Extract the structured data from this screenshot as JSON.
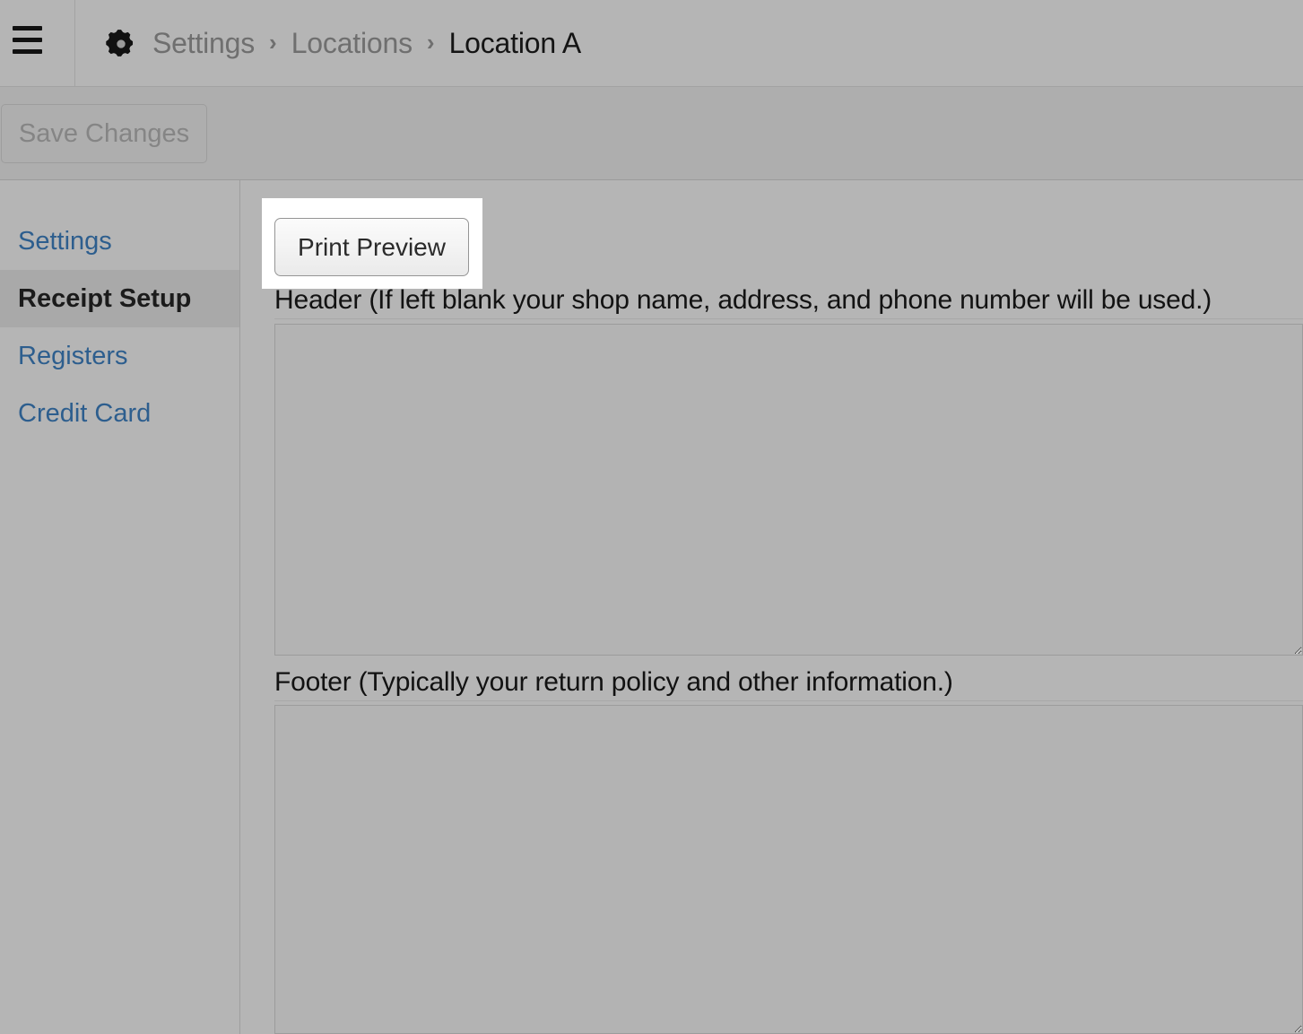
{
  "header": {
    "menu_icon": "hamburger-menu-icon",
    "app_icon": "gear-icon",
    "breadcrumb": [
      {
        "label": "Settings",
        "current": false
      },
      {
        "label": "Locations",
        "current": false
      },
      {
        "label": "Location A",
        "current": true
      }
    ],
    "separator": "›"
  },
  "toolbar": {
    "save_label": "Save Changes",
    "save_disabled": true
  },
  "sidebar": {
    "items": [
      {
        "label": "Settings",
        "active": false
      },
      {
        "label": "Receipt Setup",
        "active": true
      },
      {
        "label": "Registers",
        "active": false
      },
      {
        "label": "Credit Card",
        "active": false
      }
    ]
  },
  "main": {
    "print_preview_label": "Print Preview",
    "header_field": {
      "label": "Header (If left blank your shop name, address, and phone number will be used.)",
      "value": "",
      "placeholder": ""
    },
    "footer_field": {
      "label": "Footer (Typically your return policy and other information.)",
      "value": "",
      "placeholder": ""
    }
  },
  "colors": {
    "page_background": "#b5b5b5",
    "toolbar_background": "#aeaeae",
    "link_blue": "#2d5e8e",
    "active_row": "#a9a9a9",
    "highlight_box": "#ffffff",
    "text_dark": "#141414",
    "text_muted": "#6f6f6f"
  }
}
